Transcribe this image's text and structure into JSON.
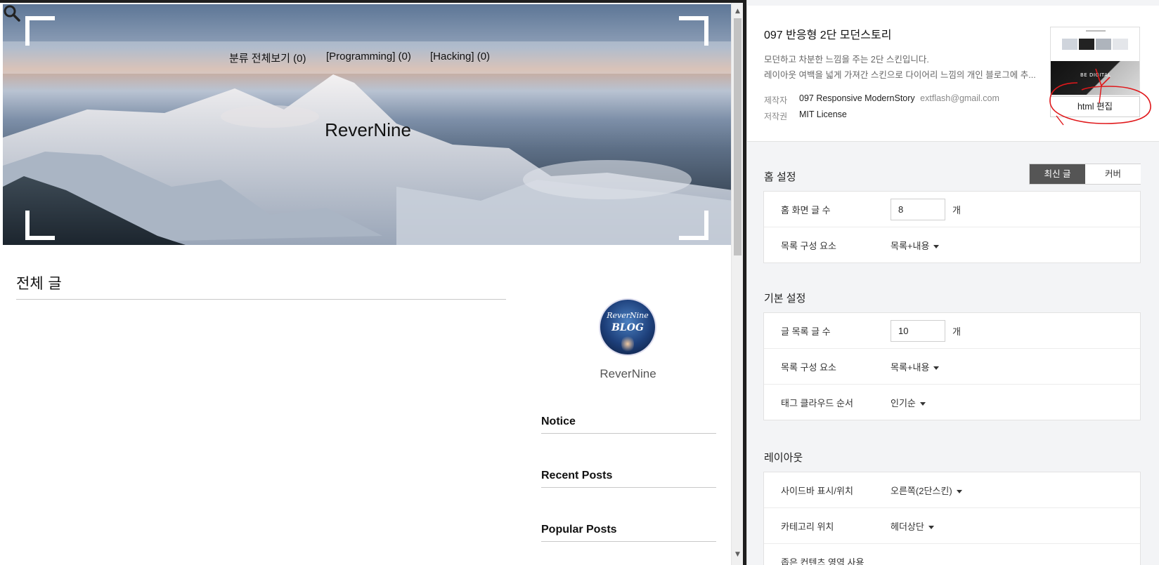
{
  "preview": {
    "nav": {
      "all": "분류 전체보기 (0)",
      "programming": "[Programming] (0)",
      "hacking": "[Hacking] (0)"
    },
    "hero_title": "ReverNine",
    "section_title": "전체 글",
    "sidebar": {
      "blog_name": "ReverNine",
      "widgets": [
        "Notice",
        "Recent Posts",
        "Popular Posts"
      ]
    },
    "avatar_text": {
      "line1": "ReverNine",
      "line2": "BLOG"
    }
  },
  "skin": {
    "name": "097 반응형 2단 모던스토리",
    "desc_line1": "모던하고 차분한 느낌을 주는 2단 스킨입니다.",
    "desc_line2": "레이아웃 여백을 넓게 가져간 스킨으로 다이어리 느낌의 개인 블로그에 추...",
    "author_label": "제작자",
    "author": "097 Responsive ModernStory",
    "author_email": "extflash@gmail.com",
    "license_label": "저작권",
    "license": "MIT License",
    "thumb_text": "BE DIGITAL",
    "html_edit_label": "html 편집"
  },
  "home_settings": {
    "title": "홈 설정",
    "tabs": [
      "최신 글",
      "커버"
    ],
    "post_count_label": "홈 화면 글 수",
    "post_count": "8",
    "unit": "개",
    "list_type_label": "목록 구성 요소",
    "list_type": "목록+내용"
  },
  "basic_settings": {
    "title": "기본 설정",
    "list_count_label": "글 목록 글 수",
    "list_count": "10",
    "unit": "개",
    "list_type_label": "목록 구성 요소",
    "list_type": "목록+내용",
    "tag_order_label": "태그 클라우드 순서",
    "tag_order": "인기순"
  },
  "layout_settings": {
    "title": "레이아웃",
    "sidebar_label": "사이드바 표시/위치",
    "sidebar_value": "오른쪽(2단스킨)",
    "category_label": "카테고리 위치",
    "category_value": "헤더상단",
    "narrow_label": "좁은 컨텐츠 영역 사용"
  },
  "colors": {
    "accent_dark": "#555555",
    "annotation_red": "#e0181b"
  }
}
